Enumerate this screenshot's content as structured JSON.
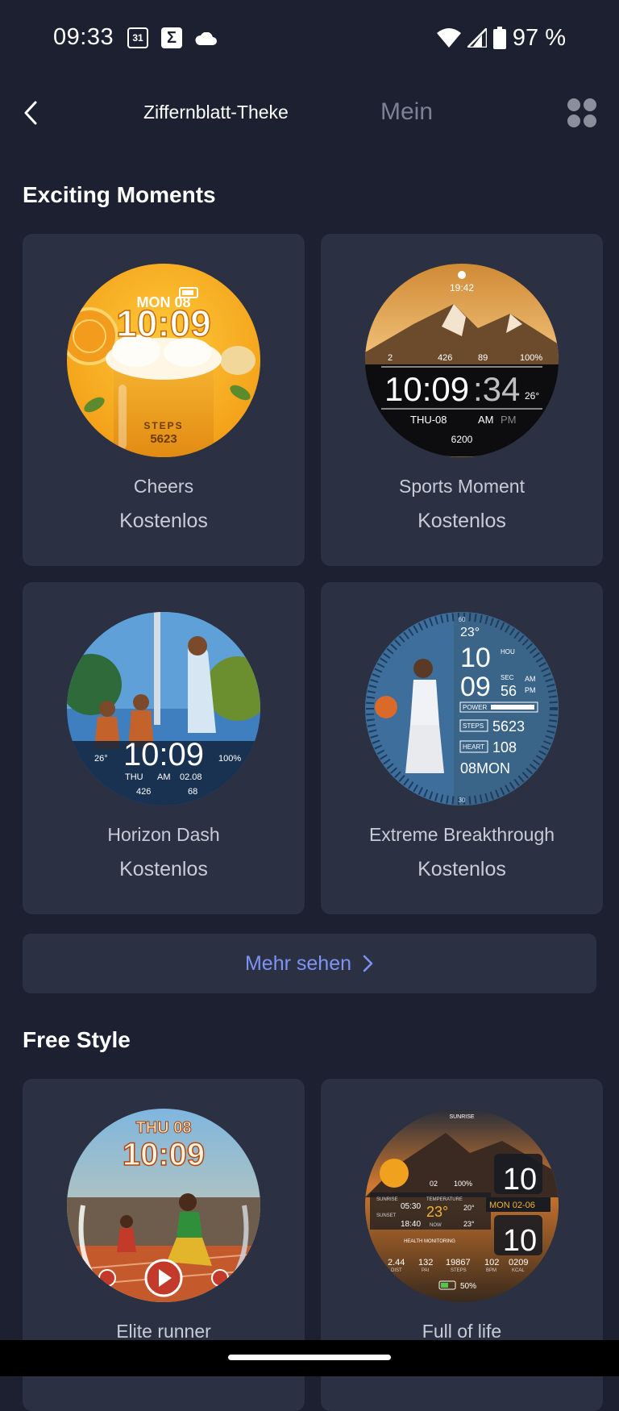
{
  "status_bar": {
    "time": "09:33",
    "calendar_day": "31",
    "sigma": "Σ",
    "battery": "97 %"
  },
  "nav": {
    "title": "Ziffernblatt-Theke",
    "tab_mine": "Mein"
  },
  "sections": [
    {
      "title": "Exciting Moments",
      "cards": [
        {
          "name": "Cheers",
          "price": "Kostenlos",
          "face": {
            "day": "MON 08",
            "time": "10:09",
            "steps_label": "STEPS",
            "steps": "5623"
          }
        },
        {
          "name": "Sports Moment",
          "price": "Kostenlos",
          "face": {
            "top_time": "19:42",
            "stat1": "2",
            "stat2": "426",
            "stat3": "89",
            "stat4": "100%",
            "time": "10:09",
            "seconds": ":34",
            "temp": "26°",
            "date": "THU-08",
            "am": "AM",
            "pm": "PM",
            "steps": "6200"
          }
        },
        {
          "name": "Horizon Dash",
          "price": "Kostenlos",
          "face": {
            "temp": "26°",
            "time": "10:09",
            "battery": "100%",
            "day": "THU",
            "am": "AM",
            "date": "02.08",
            "stat1": "426",
            "stat2": "68"
          }
        },
        {
          "name": "Extreme Breakthrough",
          "price": "Kostenlos",
          "face": {
            "temp": "23°",
            "hour": "10",
            "hou_label": "HOU",
            "minute": "09",
            "sec_label": "SEC",
            "seconds": "56",
            "am": "AM",
            "pm": "PM",
            "power_label": "POWER",
            "steps_label": "STEPS",
            "steps": "5623",
            "heart_label": "HEART",
            "heart": "108",
            "date": "08MON",
            "ring_top": "60",
            "ring_bottom": "30"
          }
        }
      ]
    },
    {
      "title": "Free Style",
      "cards": [
        {
          "name": "Elite runner",
          "price": "",
          "face": {
            "day": "THU 08",
            "time": "10:09"
          }
        },
        {
          "name": "Full of life",
          "price": "",
          "face": {
            "sunrise_top": "SUNRISE",
            "hour": "10",
            "minute": "10",
            "stat1": "02",
            "stat2": "100%",
            "sunrise_label": "SUNRISE",
            "sunrise": "05:30",
            "sunset_label": "SUNSET",
            "sunset": "18:40",
            "temp_label": "TEMPERATURE",
            "temp": "23°",
            "high": "20°",
            "low": "23°",
            "now": "NOW",
            "date": "MON 02-06",
            "health": "HEALTH MONITORING",
            "dist": "2.44",
            "dist_label": "DIST",
            "pai": "132",
            "pai_label": "PAI",
            "steps": "19867",
            "steps_label": "STEPS",
            "bpm": "102",
            "bpm_label": "BPM",
            "kcal": "0209",
            "kcal_label": "KCAL",
            "battery": "50%"
          }
        }
      ]
    }
  ],
  "more_button": {
    "label": "Mehr sehen"
  },
  "colors": {
    "background": "#1c2030",
    "card": "#2b3042",
    "accent": "#7f93f5",
    "muted": "#7c8194"
  }
}
